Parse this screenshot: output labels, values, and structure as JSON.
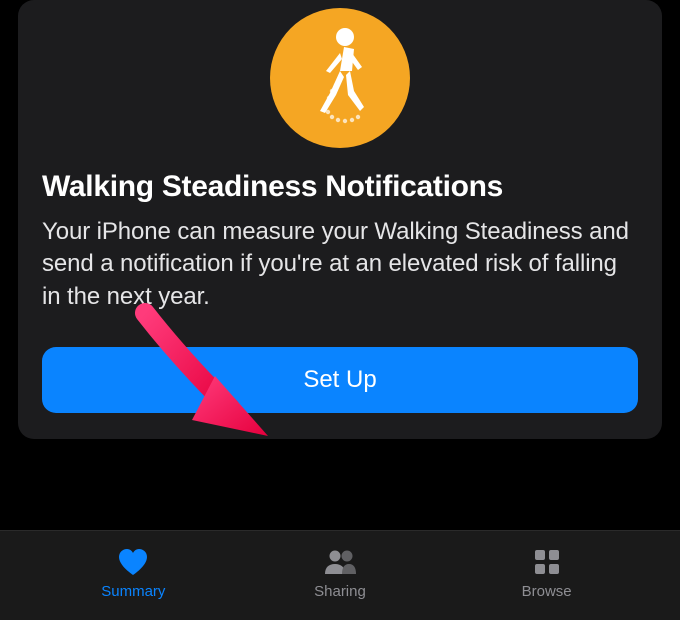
{
  "card": {
    "title": "Walking Steadiness Notifications",
    "description": "Your iPhone can measure your Walking Steadiness and send a notification if you're at an elevated risk of falling in the next year.",
    "button_label": "Set Up"
  },
  "tabbar": {
    "summary": "Summary",
    "sharing": "Sharing",
    "browse": "Browse"
  },
  "colors": {
    "accent": "#0a84ff",
    "icon_bg": "#f5a623"
  }
}
